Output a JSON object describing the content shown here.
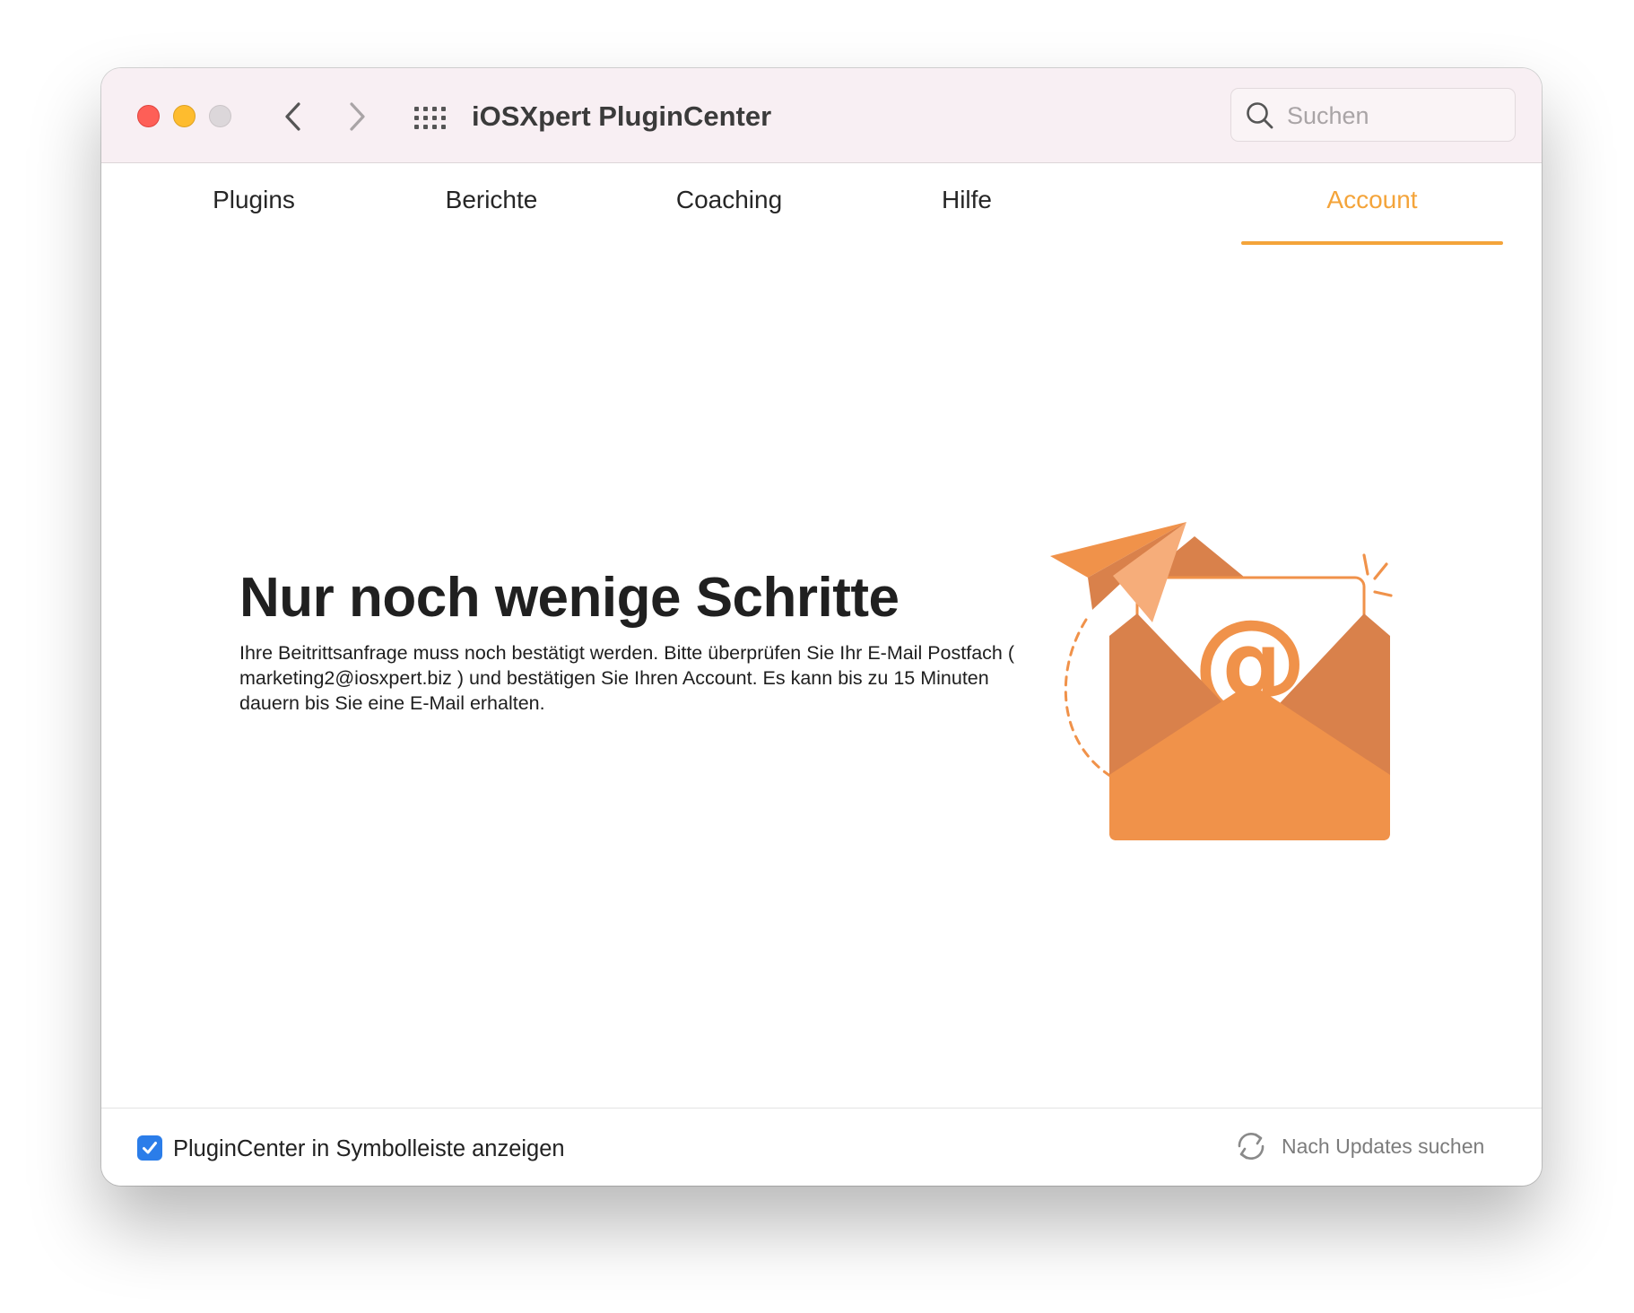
{
  "window": {
    "title": "iOSXpert PluginCenter"
  },
  "search": {
    "placeholder": "Suchen",
    "value": ""
  },
  "tabs": [
    {
      "label": "Plugins",
      "active": false
    },
    {
      "label": "Berichte",
      "active": false
    },
    {
      "label": "Coaching",
      "active": false
    },
    {
      "label": "Hilfe",
      "active": false
    },
    {
      "label": "Account",
      "active": true
    }
  ],
  "content": {
    "title": "Nur noch wenige Schritte",
    "text": "Ihre Beitrittsanfrage muss noch bestätigt werden. Bitte überprüfen Sie Ihr E-Mail Postfach ( marketing2@iosxpert.biz ) und bestätigen Sie Ihren Account. Es kann bis zu 15 Minuten dauern bis Sie eine E-Mail erhalten."
  },
  "illustration": {
    "symbol": "@"
  },
  "footer": {
    "checkbox_label": "PluginCenter in Symbolleiste anzeigen",
    "checkbox_checked": true,
    "update_label": "Nach Updates suchen"
  },
  "colors": {
    "accent": "#f4a43a",
    "envelope_dark": "#d9814b",
    "envelope_light": "#f0924a",
    "checkbox_blue": "#2b7de9",
    "titlebar": "#f8eff3"
  },
  "icons": {
    "back": "chevron-left-icon",
    "forward": "chevron-right-icon",
    "apps": "grid-icon",
    "search": "search-icon",
    "refresh": "refresh-icon",
    "check": "checkmark-icon"
  }
}
